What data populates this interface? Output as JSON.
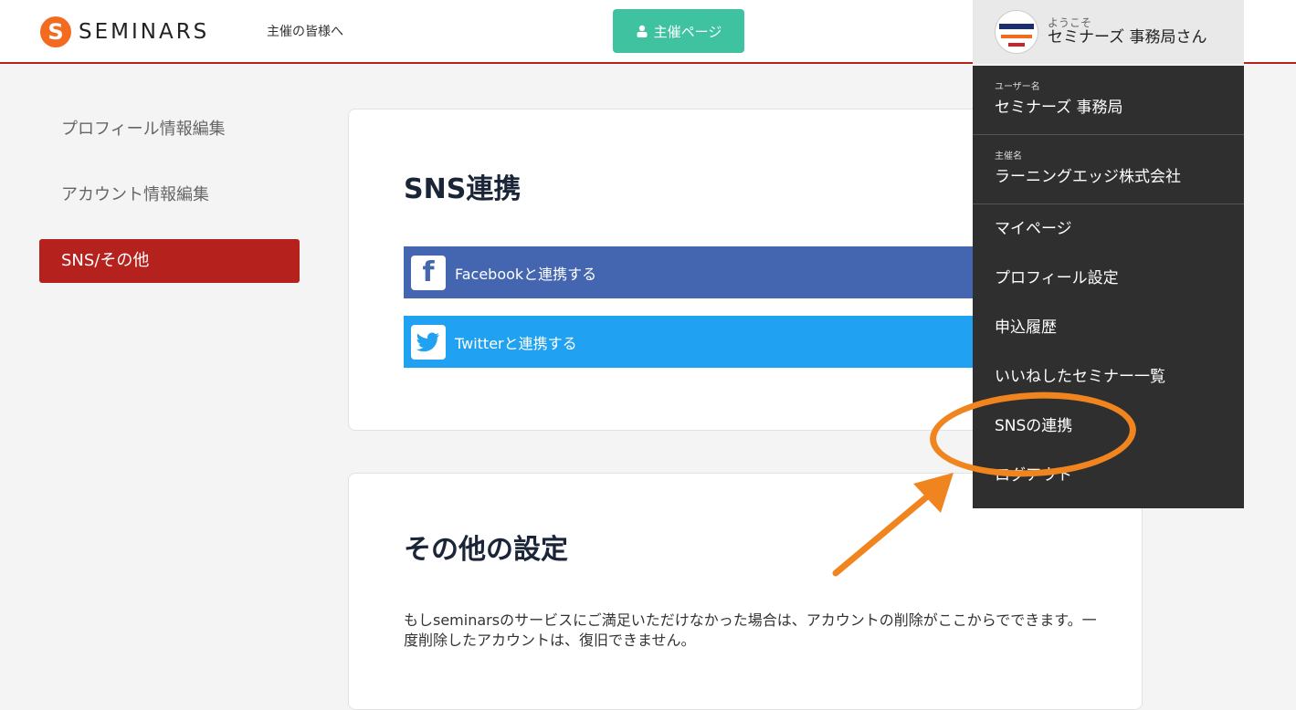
{
  "header": {
    "logo_mark": "S",
    "logo_text": "SEMINARS",
    "tagline": "主催の皆様へ",
    "host_button": "主催ページ",
    "greeting_small": "ようこそ",
    "greeting_name": "セミナーズ 事務局さん"
  },
  "sidebar": {
    "items": [
      {
        "label": "プロフィール情報編集"
      },
      {
        "label": "アカウント情報編集"
      },
      {
        "label": "SNS/その他"
      }
    ]
  },
  "sns_card": {
    "title": "SNS連携",
    "facebook_label": "Facebookと連携する",
    "twitter_label": "Twitterと連携する"
  },
  "other_card": {
    "title": "その他の設定",
    "text": "もしseminarsのサービスにご満足いただけなかった場合は、アカウントの削除がここからでできます。一度削除したアカウントは、復旧できません。"
  },
  "dropdown": {
    "username_label": "ユーザー名",
    "username": "セミナーズ 事務局",
    "host_label": "主催名",
    "host_name": "ラーニングエッジ株式会社",
    "items": [
      {
        "label": "マイページ"
      },
      {
        "label": "プロフィール設定"
      },
      {
        "label": "申込履歴"
      },
      {
        "label": "いいねしたセミナー一覧"
      },
      {
        "label": "SNSの連携"
      },
      {
        "label": "ログアウト"
      }
    ]
  },
  "colors": {
    "accent_red": "#b5221e",
    "teal": "#3ec2a0",
    "facebook": "#4466b0",
    "twitter": "#21a1f1",
    "annotation": "#f0841e"
  }
}
